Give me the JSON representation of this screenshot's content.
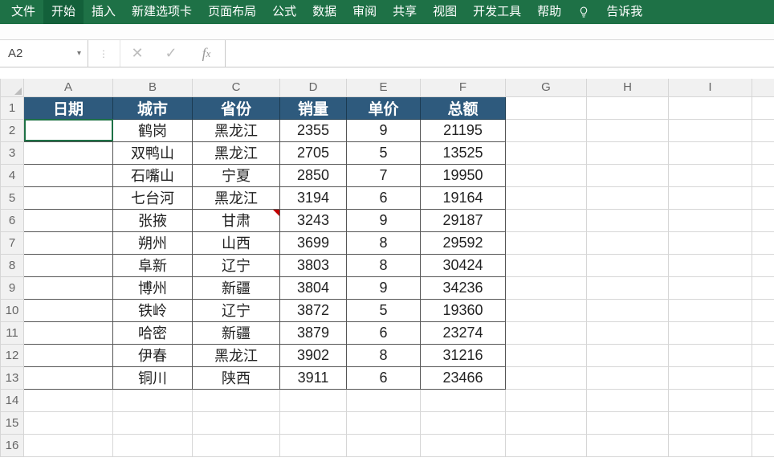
{
  "menu": {
    "items": [
      "文件",
      "开始",
      "插入",
      "新建选项卡",
      "页面布局",
      "公式",
      "数据",
      "审阅",
      "共享",
      "视图",
      "开发工具",
      "帮助"
    ],
    "tell_me": "告诉我"
  },
  "namebox": {
    "value": "A2"
  },
  "formula": {
    "value": ""
  },
  "columns": [
    "A",
    "B",
    "C",
    "D",
    "E",
    "F",
    "G",
    "H",
    "I"
  ],
  "row_numbers": [
    "1",
    "2",
    "3",
    "4",
    "5",
    "6",
    "7",
    "8",
    "9",
    "10",
    "11",
    "12",
    "13",
    "14",
    "15",
    "16"
  ],
  "headers": [
    "日期",
    "城市",
    "省份",
    "销量",
    "单价",
    "总额"
  ],
  "rows": [
    {
      "date": "",
      "city": "鹤岗",
      "prov": "黑龙江",
      "qty": "2355",
      "price": "9",
      "total": "21195"
    },
    {
      "date": "",
      "city": "双鸭山",
      "prov": "黑龙江",
      "qty": "2705",
      "price": "5",
      "total": "13525"
    },
    {
      "date": "",
      "city": "石嘴山",
      "prov": "宁夏",
      "qty": "2850",
      "price": "7",
      "total": "19950"
    },
    {
      "date": "",
      "city": "七台河",
      "prov": "黑龙江",
      "qty": "3194",
      "price": "6",
      "total": "19164"
    },
    {
      "date": "",
      "city": "张掖",
      "prov": "甘肃",
      "qty": "3243",
      "price": "9",
      "total": "29187"
    },
    {
      "date": "",
      "city": "朔州",
      "prov": "山西",
      "qty": "3699",
      "price": "8",
      "total": "29592"
    },
    {
      "date": "",
      "city": "阜新",
      "prov": "辽宁",
      "qty": "3803",
      "price": "8",
      "total": "30424"
    },
    {
      "date": "",
      "city": "博州",
      "prov": "新疆",
      "qty": "3804",
      "price": "9",
      "total": "34236"
    },
    {
      "date": "",
      "city": "铁岭",
      "prov": "辽宁",
      "qty": "3872",
      "price": "5",
      "total": "19360"
    },
    {
      "date": "",
      "city": "哈密",
      "prov": "新疆",
      "qty": "3879",
      "price": "6",
      "total": "23274"
    },
    {
      "date": "",
      "city": "伊春",
      "prov": "黑龙江",
      "qty": "3902",
      "price": "8",
      "total": "31216"
    },
    {
      "date": "",
      "city": "铜川",
      "prov": "陕西",
      "qty": "3911",
      "price": "6",
      "total": "23466"
    }
  ],
  "active_cell": "A2",
  "comment_cell": "C6",
  "colors": {
    "ribbon": "#1e7146",
    "headerFill": "#2e5a7d"
  }
}
